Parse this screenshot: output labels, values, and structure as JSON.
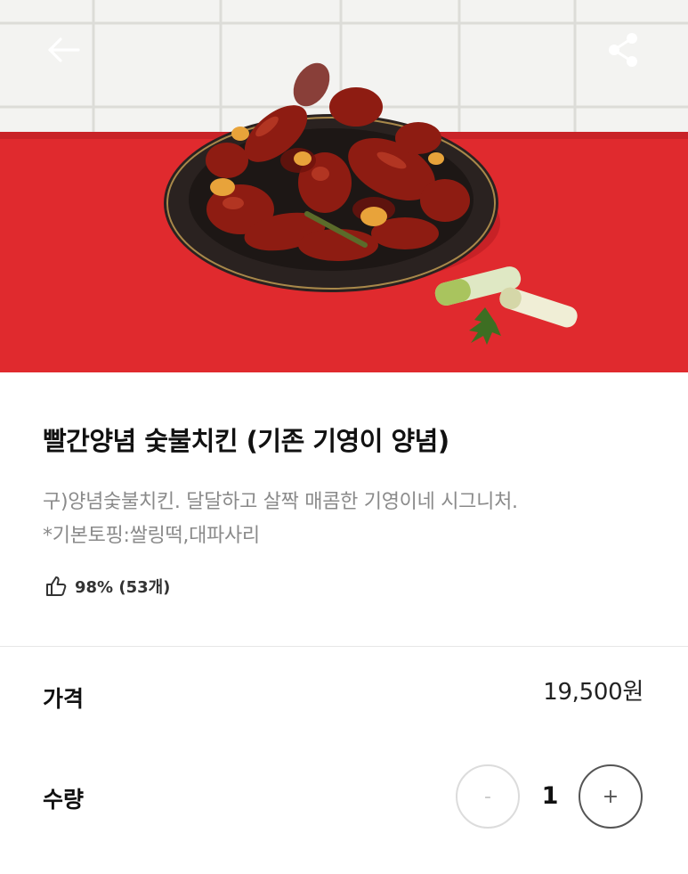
{
  "header": {
    "back_icon": "arrow-left-icon",
    "share_icon": "share-icon"
  },
  "hero": {
    "image_alt": "빨간양념 숯불치킨 (기존 기영이 양념)",
    "colors": {
      "table_red": "#e02a2e",
      "wall": "#f3f3f1"
    }
  },
  "product": {
    "title": "빨간양념 숯불치킨 (기존 기영이 양념)",
    "description_line1": "구)양념숯불치킨. 달달하고 살짝 매콤한 기영이네 시그니처.",
    "description_line2": "*기본토핑:쌀링떡,대파사리",
    "rating_icon": "thumbs-up-icon",
    "rating_text": "98% (53개)"
  },
  "order": {
    "price_label": "가격",
    "price_value": "19,500원",
    "quantity_label": "수량",
    "quantity_value": "1",
    "minus_label": "-",
    "plus_label": "+"
  }
}
